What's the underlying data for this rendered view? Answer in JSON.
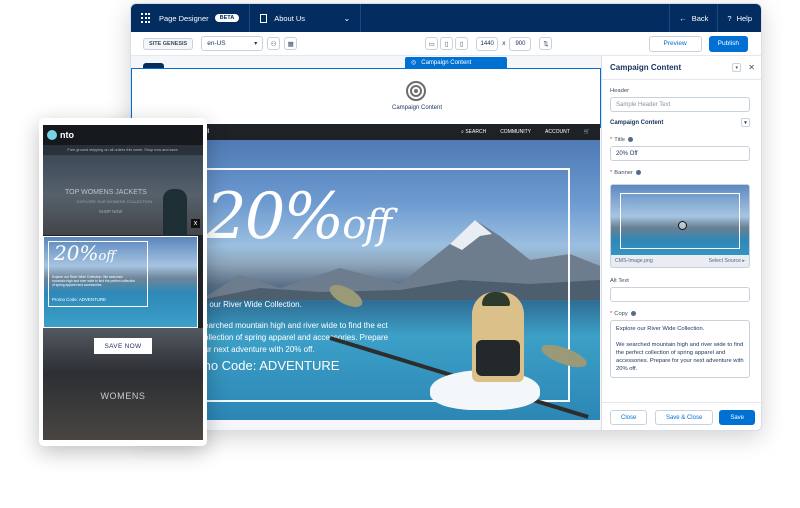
{
  "app": {
    "title": "Page Designer",
    "badge": "BETA",
    "page_selector": "About Us",
    "back_label": "Back",
    "help_label": "Help"
  },
  "toolbar": {
    "site_badge": "SITE GENESIS",
    "locale": "en-US",
    "width_value": "1440",
    "times": "x",
    "height_value": "900",
    "preview_label": "Preview",
    "publish_label": "Publish"
  },
  "canvas": {
    "selected_tab": "Campaign Content",
    "component_label": "Campaign Content",
    "site_nav": {
      "brand": "rail",
      "links": [
        "SEARCH",
        "COMMUNITY",
        "ACCOUNT"
      ]
    },
    "hero": {
      "headline": "20%",
      "headline_suffix": "off",
      "line1": "re our River Wide Collection.",
      "line2": "searched mountain high and river wide to find the ect collection of spring apparel and accessories. Prepare our next adventure with 20% off.",
      "promo": "mo Code: ADVENTURE"
    }
  },
  "panel": {
    "title": "Campaign Content",
    "header_label": "Header",
    "header_placeholder": "Sample Header Text",
    "section_label": "Campaign Content",
    "title_label": "Title",
    "title_value": "20% Off",
    "banner_label": "Banner",
    "banner_file": "CMS-Image.png",
    "banner_source": "Select Source",
    "alt_label": "Alt Text",
    "alt_value": "",
    "copy_label": "Copy",
    "copy_p1": "Explore our River Wide Collection.",
    "copy_p2": "We searched mountain high and river wide to find the perfect collection of spring apparel and accessories. Prepare for your next adventure with 20% off.",
    "close_label": "Close",
    "save_close_label": "Save & Close",
    "save_label": "Save"
  },
  "phone": {
    "brand": "nto",
    "shipping_strip": "Free ground shipping on all orders this week. Shop now and save.",
    "hero_title": "TOP WOMENS JACKETS",
    "hero_sub": "EXPLORE OUR WOMENS COLLECTION",
    "hero_cta": "SHOP NOW",
    "modal_headline": "20%",
    "modal_suffix": "off",
    "modal_body": "Explore our River Wide Collection. We searched mountain high and river wide to find the perfect collection of spring apparel and accessories.",
    "modal_promo": "Promo Code: ADVENTURE",
    "close_glyph": "x",
    "save_now": "SAVE NOW",
    "womens": "WOMENS"
  },
  "colors": {
    "brand_navy": "#032d60",
    "accent_blue": "#0070d2",
    "required_red": "#c23934"
  },
  "icons": [
    "apps-icon",
    "document-icon",
    "chevron-down-icon",
    "back-arrow-icon",
    "help-icon",
    "people-icon",
    "calendar-icon",
    "monitor-icon",
    "tablet-icon",
    "phone-icon",
    "swap-icon",
    "plus-icon",
    "list-icon",
    "target-icon",
    "search-icon",
    "cart-icon",
    "close-icon",
    "info-icon"
  ]
}
